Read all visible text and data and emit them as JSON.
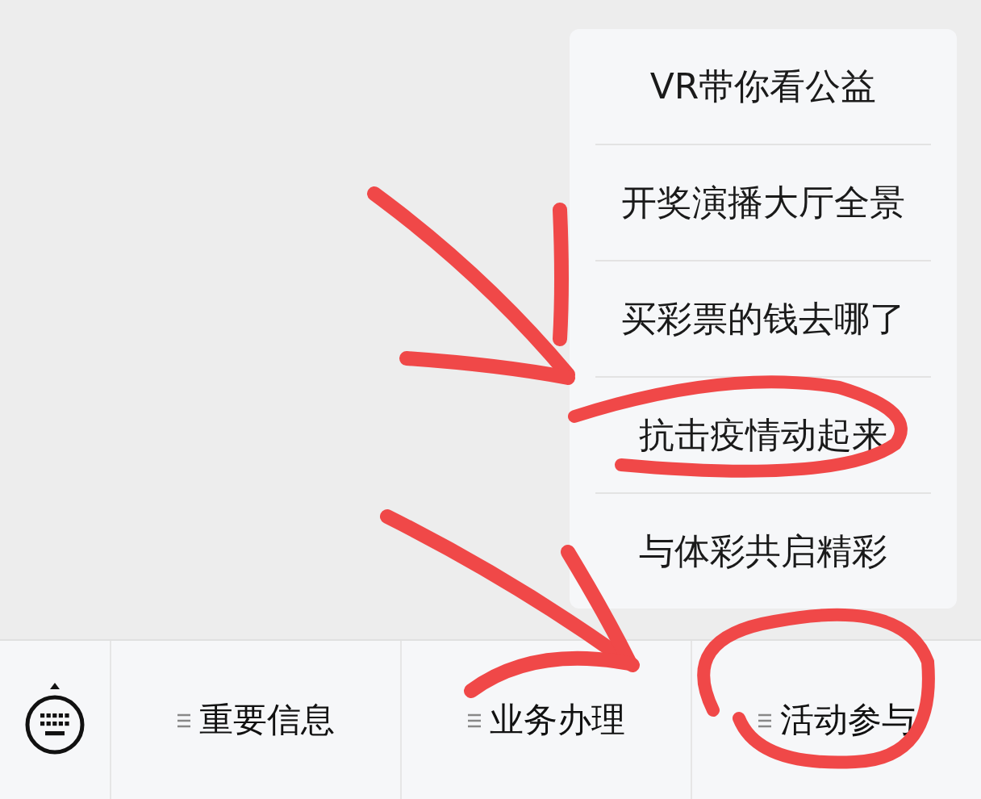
{
  "menu_bar": {
    "items": [
      {
        "label": "重要信息"
      },
      {
        "label": "业务办理"
      },
      {
        "label": "活动参与",
        "children": [
          {
            "label": "VR带你看公益"
          },
          {
            "label": "开奖演播大厅全景"
          },
          {
            "label": "买彩票的钱去哪了"
          },
          {
            "label": "抗击疫情动起来"
          },
          {
            "label": "与体彩共启精彩"
          }
        ]
      }
    ]
  }
}
